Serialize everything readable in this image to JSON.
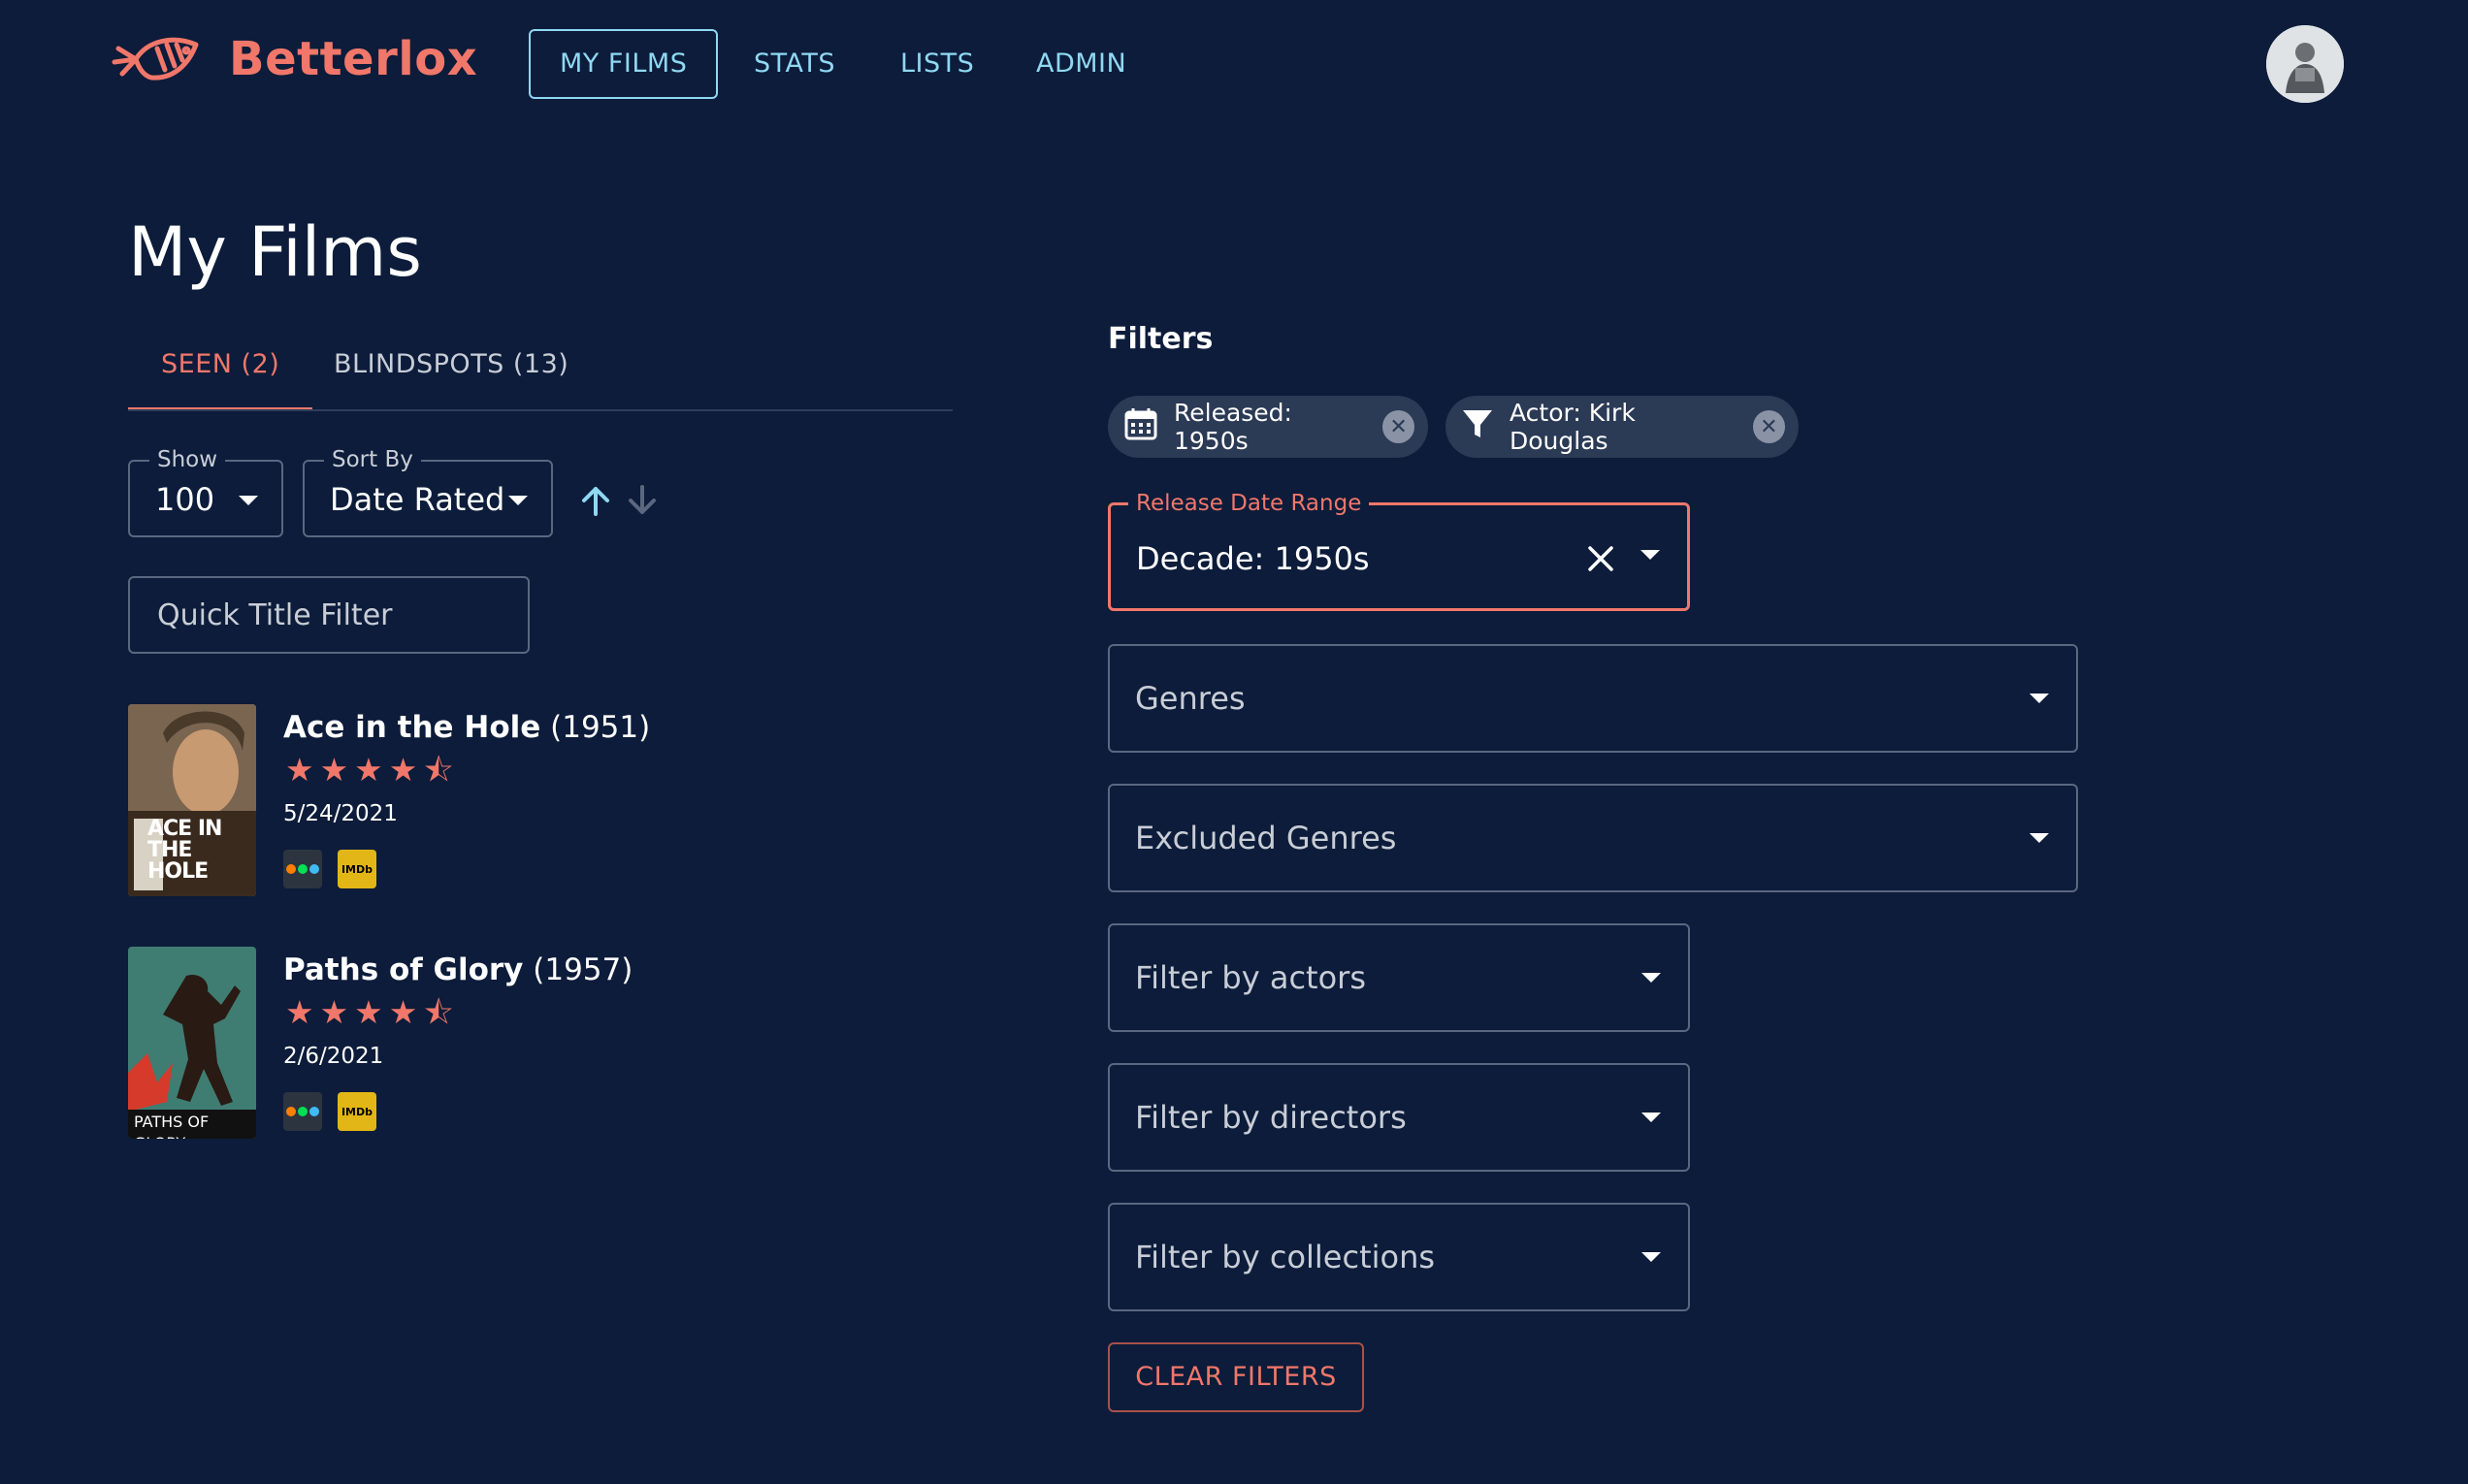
{
  "app": {
    "name": "Betterlox"
  },
  "nav": {
    "items": [
      {
        "label": "MY FILMS",
        "active": true
      },
      {
        "label": "STATS",
        "active": false
      },
      {
        "label": "LISTS",
        "active": false
      },
      {
        "label": "ADMIN",
        "active": false
      }
    ]
  },
  "page": {
    "title": "My Films"
  },
  "tabs": [
    {
      "label": "SEEN (2)",
      "active": true
    },
    {
      "label": "BLINDSPOTS (13)",
      "active": false
    }
  ],
  "controls": {
    "show": {
      "label": "Show",
      "value": "100"
    },
    "sort_by": {
      "label": "Sort By",
      "value": "Date Rated"
    },
    "quick_filter_placeholder": "Quick Title Filter"
  },
  "films": [
    {
      "title": "Ace in the Hole",
      "year": "(1951)",
      "rating": 4.5,
      "stars": "★★★★⯪",
      "date": "5/24/2021",
      "poster_text": "ACE IN THE HOLE",
      "imdb_label": "IMDb"
    },
    {
      "title": "Paths of Glory",
      "year": "(1957)",
      "rating": 4.5,
      "stars": "★★★★⯪",
      "date": "2/6/2021",
      "poster_text": "PATHS OF GLORY",
      "imdb_label": "IMDb"
    }
  ],
  "filters": {
    "heading": "Filters",
    "chips": [
      {
        "label": "Released: 1950s",
        "icon": "calendar-icon"
      },
      {
        "label": "Actor: Kirk Douglas",
        "icon": "filter-funnel-icon"
      }
    ],
    "release_date_range": {
      "label": "Release Date Range",
      "value": "Decade: 1950s"
    },
    "genres_placeholder": "Genres",
    "excluded_genres_placeholder": "Excluded Genres",
    "actors_placeholder": "Filter by actors",
    "directors_placeholder": "Filter by directors",
    "collections_placeholder": "Filter by collections",
    "clear_label": "CLEAR FILTERS"
  },
  "colors": {
    "background": "#0c1c3a",
    "accent": "#f0776a",
    "nav_link": "#8fd8f2",
    "chip_bg": "#2b3a55"
  }
}
